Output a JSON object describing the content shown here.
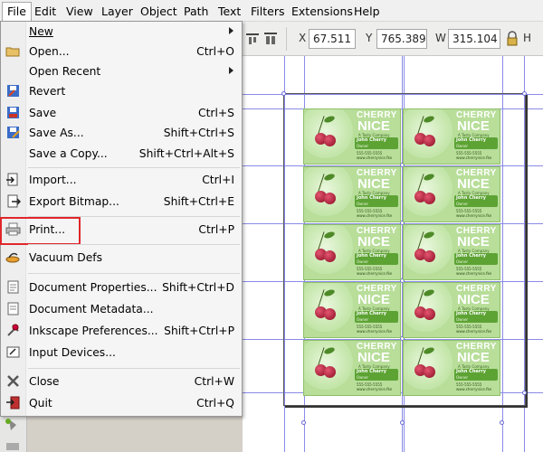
{
  "menubar": {
    "items": [
      {
        "label": "File",
        "active": true
      },
      {
        "label": "Edit"
      },
      {
        "label": "View"
      },
      {
        "label": "Layer"
      },
      {
        "label": "Object"
      },
      {
        "label": "Path"
      },
      {
        "label": "Text"
      },
      {
        "label": "Filters"
      },
      {
        "label": "Extensions"
      },
      {
        "label": "Help"
      }
    ]
  },
  "toolbar": {
    "x_label": "X",
    "x_value": "67.511",
    "y_label": "Y",
    "y_value": "765.389",
    "w_label": "W",
    "w_value": "315.104"
  },
  "file_menu": {
    "items": [
      {
        "label": "New",
        "shortcut": "",
        "submenu": true,
        "icon": "new-icon"
      },
      {
        "label": "Open...",
        "shortcut": "Ctrl+O",
        "icon": "open-folder-icon"
      },
      {
        "label": "Open Recent",
        "shortcut": "",
        "submenu": true,
        "icon": "recent-icon"
      },
      {
        "label": "Revert",
        "shortcut": "",
        "icon": "revert-icon"
      },
      {
        "label": "Save",
        "shortcut": "Ctrl+S",
        "icon": "save-icon"
      },
      {
        "label": "Save As...",
        "shortcut": "Shift+Ctrl+S",
        "icon": "save-as-icon"
      },
      {
        "label": "Save a Copy...",
        "shortcut": "Shift+Ctrl+Alt+S",
        "icon": "save-copy-icon"
      },
      {
        "label": "Import...",
        "shortcut": "Ctrl+I",
        "icon": "import-icon"
      },
      {
        "label": "Export Bitmap...",
        "shortcut": "Shift+Ctrl+E",
        "icon": "export-icon"
      },
      {
        "label": "Print...",
        "shortcut": "Ctrl+P",
        "icon": "printer-icon",
        "highlighted": true
      },
      {
        "label": "Vacuum Defs",
        "shortcut": "",
        "icon": "vacuum-icon"
      },
      {
        "label": "Document Properties...",
        "shortcut": "Shift+Ctrl+D",
        "icon": "document-properties-icon"
      },
      {
        "label": "Document Metadata...",
        "shortcut": "",
        "icon": "metadata-icon"
      },
      {
        "label": "Inkscape Preferences...",
        "shortcut": "Shift+Ctrl+P",
        "icon": "preferences-icon"
      },
      {
        "label": "Input Devices...",
        "shortcut": "",
        "icon": "input-devices-icon"
      },
      {
        "label": "Close",
        "shortcut": "Ctrl+W",
        "icon": "close-icon"
      },
      {
        "label": "Quit",
        "shortcut": "Ctrl+Q",
        "icon": "quit-icon"
      }
    ]
  },
  "card": {
    "brand_line1": "CHERRY",
    "brand_line2": "NICE",
    "tagline": "A Tasty Company",
    "name": "John Cherry",
    "role": "Owner",
    "phone": "555-555-5555",
    "web": "www.cherrynice.fke"
  },
  "colors": {
    "highlight_border": "#e0272b",
    "card_green": "#b8de9a",
    "guide_blue": "#8a8ae8"
  }
}
